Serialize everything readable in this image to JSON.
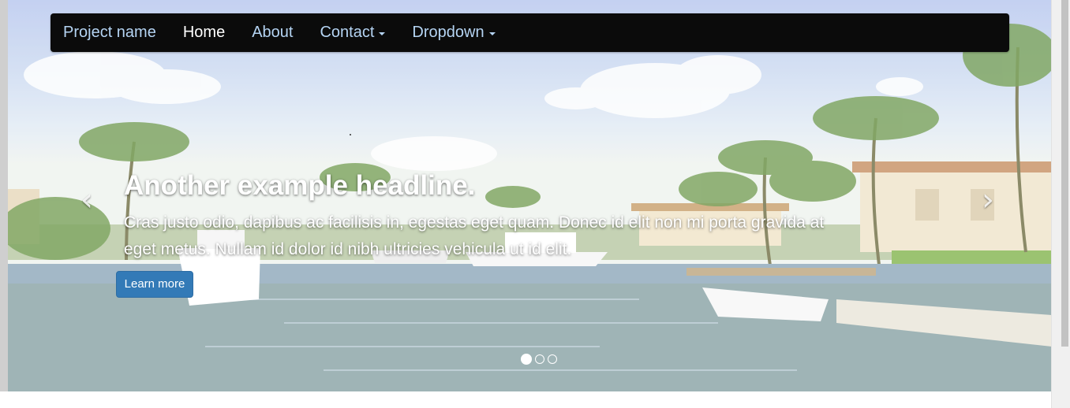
{
  "navbar": {
    "brand": "Project name",
    "items": [
      {
        "label": "Home",
        "active": true,
        "dropdown": false
      },
      {
        "label": "About",
        "active": false,
        "dropdown": false
      },
      {
        "label": "Contact",
        "active": false,
        "dropdown": true
      },
      {
        "label": "Dropdown",
        "active": false,
        "dropdown": true
      }
    ]
  },
  "carousel": {
    "headline": "Another example headline.",
    "text": "Cras justo odio, dapibus ac facilisis in, egestas eget quam. Donec id elit non mi porta gravida at eget metus. Nullam id dolor id nibh ultricies vehicula ut id elit.",
    "button_label": "Learn more",
    "prev_icon": "chevron-left-icon",
    "next_icon": "chevron-right-icon",
    "slide_count": 3,
    "active_slide": 1
  },
  "colors": {
    "navbar_bg": "#0b0b0b",
    "nav_link": "#b5d4f3",
    "nav_active": "#ffffff",
    "button_primary": "#337ab7"
  }
}
